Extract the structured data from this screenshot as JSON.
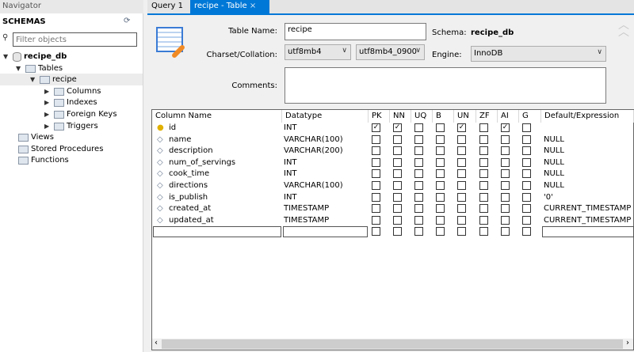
{
  "navigator": {
    "title": "Navigator",
    "schemas_label": "SCHEMAS",
    "filter_placeholder": "Filter objects",
    "tree": [
      {
        "label": "recipe_db",
        "bold": true,
        "level": 0,
        "expanded": true,
        "icon": "database-icon"
      },
      {
        "label": "Tables",
        "level": 1,
        "expanded": true,
        "icon": "folder-icon"
      },
      {
        "label": "recipe",
        "level": 2,
        "expanded": true,
        "icon": "table-icon",
        "selected": true
      },
      {
        "label": "Columns",
        "level": 3,
        "expanded": false,
        "icon": "columns-icon"
      },
      {
        "label": "Indexes",
        "level": 3,
        "expanded": false,
        "icon": "indexes-icon"
      },
      {
        "label": "Foreign Keys",
        "level": 3,
        "expanded": false,
        "icon": "foreign-keys-icon"
      },
      {
        "label": "Triggers",
        "level": 3,
        "expanded": false,
        "icon": "triggers-icon"
      },
      {
        "label": "Views",
        "level": 1,
        "icon": "folder-icon"
      },
      {
        "label": "Stored Procedures",
        "level": 1,
        "icon": "folder-icon"
      },
      {
        "label": "Functions",
        "level": 1,
        "icon": "folder-icon"
      }
    ]
  },
  "tabs": [
    {
      "label": "Query 1",
      "active": false
    },
    {
      "label": "recipe - Table",
      "active": true,
      "close": "×"
    }
  ],
  "form": {
    "table_name_label": "Table Name:",
    "table_name": "recipe",
    "schema_label": "Schema:",
    "schema": "recipe_db",
    "charset_label": "Charset/Collation:",
    "charset": "utf8mb4",
    "collation": "utf8mb4_0900",
    "engine_label": "Engine:",
    "engine": "InnoDB",
    "comments_label": "Comments:",
    "comments": ""
  },
  "grid": {
    "headers": [
      "Column Name",
      "Datatype",
      "PK",
      "NN",
      "UQ",
      "B",
      "UN",
      "ZF",
      "AI",
      "G",
      "Default/Expression"
    ],
    "rows": [
      {
        "name": "id",
        "type": "INT",
        "flags": [
          1,
          1,
          0,
          0,
          1,
          0,
          1,
          0
        ],
        "default": "",
        "key": true
      },
      {
        "name": "name",
        "type": "VARCHAR(100)",
        "flags": [
          0,
          0,
          0,
          0,
          0,
          0,
          0,
          0
        ],
        "default": "NULL"
      },
      {
        "name": "description",
        "type": "VARCHAR(200)",
        "flags": [
          0,
          0,
          0,
          0,
          0,
          0,
          0,
          0
        ],
        "default": "NULL"
      },
      {
        "name": "num_of_servings",
        "type": "INT",
        "flags": [
          0,
          0,
          0,
          0,
          0,
          0,
          0,
          0
        ],
        "default": "NULL"
      },
      {
        "name": "cook_time",
        "type": "INT",
        "flags": [
          0,
          0,
          0,
          0,
          0,
          0,
          0,
          0
        ],
        "default": "NULL"
      },
      {
        "name": "directions",
        "type": "VARCHAR(100)",
        "flags": [
          0,
          0,
          0,
          0,
          0,
          0,
          0,
          0
        ],
        "default": "NULL"
      },
      {
        "name": "is_publish",
        "type": "INT",
        "flags": [
          0,
          0,
          0,
          0,
          0,
          0,
          0,
          0
        ],
        "default": "'0'"
      },
      {
        "name": "created_at",
        "type": "TIMESTAMP",
        "flags": [
          0,
          0,
          0,
          0,
          0,
          0,
          0,
          0
        ],
        "default": "CURRENT_TIMESTAMP"
      },
      {
        "name": "updated_at",
        "type": "TIMESTAMP",
        "flags": [
          0,
          0,
          0,
          0,
          0,
          0,
          0,
          0
        ],
        "default": "CURRENT_TIMESTAMP O"
      }
    ]
  },
  "colors": {
    "accent": "#0078d7"
  }
}
